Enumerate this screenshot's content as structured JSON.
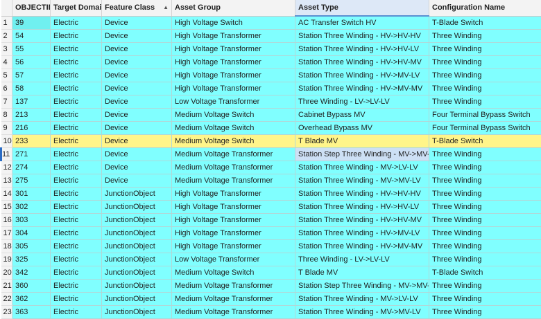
{
  "columns": [
    "OBJECTID *",
    "Target Domai...",
    "Feature Class",
    "Asset Group",
    "Asset Type",
    "Configuration Name"
  ],
  "sort_column": "Feature Class",
  "rows": [
    [
      "1",
      "39",
      "Electric",
      "Device",
      "High Voltage Switch",
      "AC Transfer Switch HV",
      "T-Blade Switch"
    ],
    [
      "2",
      "54",
      "Electric",
      "Device",
      "High Voltage Transformer",
      "Station Three Winding - HV->HV-HV",
      "Three Winding"
    ],
    [
      "3",
      "55",
      "Electric",
      "Device",
      "High Voltage Transformer",
      "Station Three Winding - HV->HV-LV",
      "Three Winding"
    ],
    [
      "4",
      "56",
      "Electric",
      "Device",
      "High Voltage Transformer",
      "Station Three Winding - HV->HV-MV",
      "Three Winding"
    ],
    [
      "5",
      "57",
      "Electric",
      "Device",
      "High Voltage Transformer",
      "Station Three Winding - HV->MV-LV",
      "Three Winding"
    ],
    [
      "6",
      "58",
      "Electric",
      "Device",
      "High Voltage Transformer",
      "Station Three Winding - HV->MV-MV",
      "Three Winding"
    ],
    [
      "7",
      "137",
      "Electric",
      "Device",
      "Low Voltage Transformer",
      "Three Winding - LV->LV-LV",
      "Three Winding"
    ],
    [
      "8",
      "213",
      "Electric",
      "Device",
      "Medium Voltage Switch",
      "Cabinet Bypass MV",
      "Four Terminal Bypass Switch"
    ],
    [
      "9",
      "216",
      "Electric",
      "Device",
      "Medium Voltage Switch",
      "Overhead Bypass MV",
      "Four Terminal Bypass Switch"
    ],
    [
      "10",
      "233",
      "Electric",
      "Device",
      "Medium Voltage Switch",
      "T Blade MV",
      "T-Blade Switch"
    ],
    [
      "11",
      "271",
      "Electric",
      "Device",
      "Medium Voltage Transformer",
      "Station Step Three Winding - MV->MV-MV",
      "Three Winding"
    ],
    [
      "12",
      "274",
      "Electric",
      "Device",
      "Medium Voltage Transformer",
      "Station Three Winding - MV->LV-LV",
      "Three Winding"
    ],
    [
      "13",
      "275",
      "Electric",
      "Device",
      "Medium Voltage Transformer",
      "Station Three Winding - MV->MV-LV",
      "Three Winding"
    ],
    [
      "14",
      "301",
      "Electric",
      "JunctionObject",
      "High Voltage Transformer",
      "Station Three Winding - HV->HV-HV",
      "Three Winding"
    ],
    [
      "15",
      "302",
      "Electric",
      "JunctionObject",
      "High Voltage Transformer",
      "Station Three Winding - HV->HV-LV",
      "Three Winding"
    ],
    [
      "16",
      "303",
      "Electric",
      "JunctionObject",
      "High Voltage Transformer",
      "Station Three Winding - HV->HV-MV",
      "Three Winding"
    ],
    [
      "17",
      "304",
      "Electric",
      "JunctionObject",
      "High Voltage Transformer",
      "Station Three Winding - HV->MV-LV",
      "Three Winding"
    ],
    [
      "18",
      "305",
      "Electric",
      "JunctionObject",
      "High Voltage Transformer",
      "Station Three Winding - HV->MV-MV",
      "Three Winding"
    ],
    [
      "19",
      "325",
      "Electric",
      "JunctionObject",
      "Low Voltage Transformer",
      "Three Winding - LV->LV-LV",
      "Three Winding"
    ],
    [
      "20",
      "342",
      "Electric",
      "JunctionObject",
      "Medium Voltage Switch",
      "T Blade MV",
      "T-Blade Switch"
    ],
    [
      "21",
      "360",
      "Electric",
      "JunctionObject",
      "Medium Voltage Transformer",
      "Station Step Three Winding - MV->MV-MV",
      "Three Winding"
    ],
    [
      "22",
      "362",
      "Electric",
      "JunctionObject",
      "Medium Voltage Transformer",
      "Station Three Winding - MV->LV-LV",
      "Three Winding"
    ],
    [
      "23",
      "363",
      "Electric",
      "JunctionObject",
      "Medium Voltage Transformer",
      "Station Three Winding - MV->MV-LV",
      "Three Winding"
    ]
  ],
  "highlighted_row_index": 9,
  "active_row_index": 10,
  "colors": {
    "row_fill": "#80ffff",
    "highlight_fill": "#fff58a",
    "header_fill": "#f3f3f3"
  }
}
